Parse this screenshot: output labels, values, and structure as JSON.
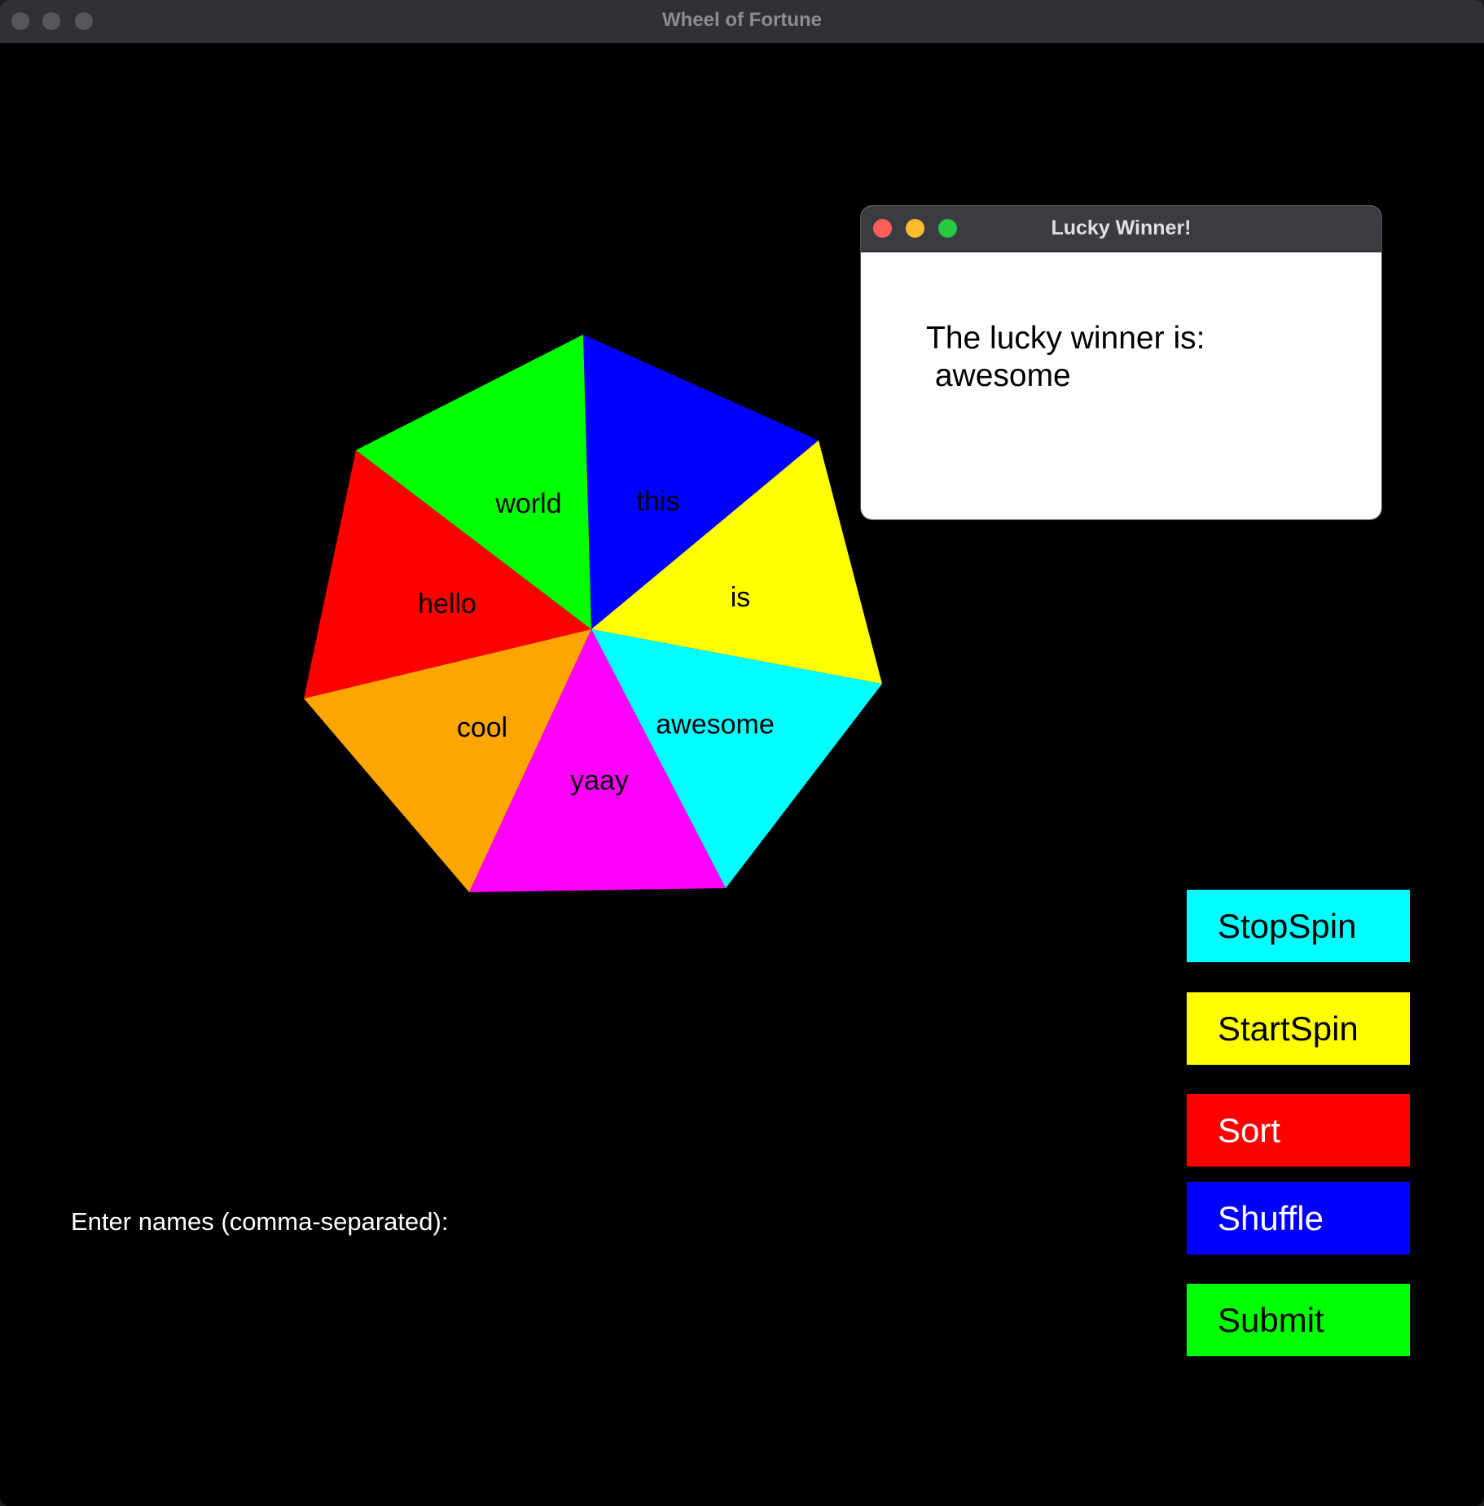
{
  "window": {
    "title": "Wheel of Fortune"
  },
  "wheel": {
    "segments": [
      {
        "label": "this",
        "color": "#0000ff"
      },
      {
        "label": "is",
        "color": "#ffff00"
      },
      {
        "label": "awesome",
        "color": "#00ffff"
      },
      {
        "label": "yaay",
        "color": "#ff00ff"
      },
      {
        "label": "cool",
        "color": "#ffa500"
      },
      {
        "label": "hello",
        "color": "#ff0000"
      },
      {
        "label": "world",
        "color": "#00ff00"
      }
    ]
  },
  "prompt": "Enter names (comma-separated):",
  "buttons": {
    "stop_spin": "StopSpin",
    "start_spin": "StartSpin",
    "sort": "Sort",
    "shuffle": "Shuffle",
    "submit": "Submit"
  },
  "colors": {
    "stop_spin": "#00ffff",
    "start_spin": "#ffff00",
    "sort": "#ff0000",
    "shuffle": "#0000ff",
    "submit": "#00ff00"
  },
  "dialog": {
    "title": "Lucky Winner!",
    "message_line1": "The lucky winner is:",
    "message_line2": " awesome"
  }
}
